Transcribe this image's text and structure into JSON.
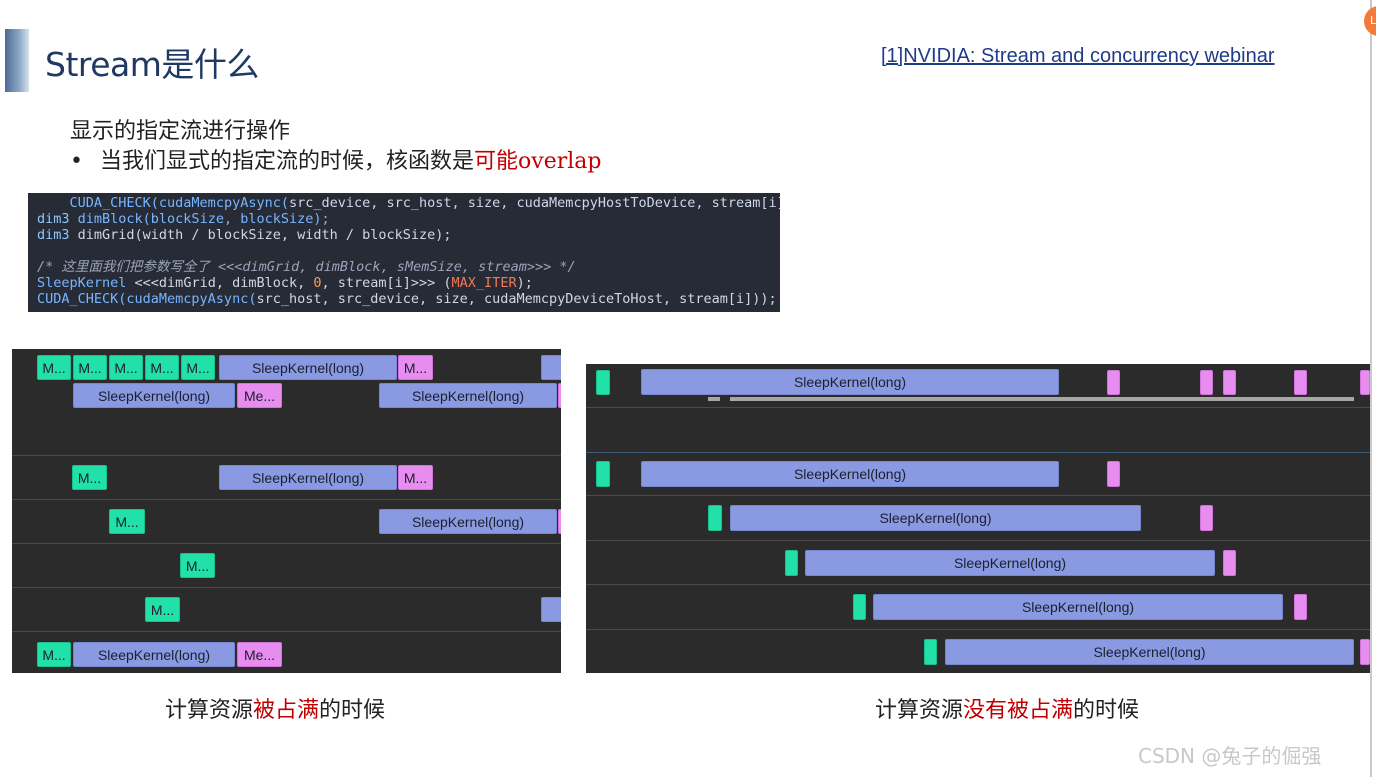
{
  "slide": {
    "title": "Stream是什么",
    "reference_link": "[1]NVIDIA: Stream and concurrency webinar",
    "badge": "L",
    "line1": "显示的指定流进行操作",
    "line2_bullet": "•",
    "line2_prefix": "当我们显式的指定流的时候，核函数是",
    "line2_highlight": "可能overlap",
    "caption_left_prefix": "计算资源",
    "caption_left_highlight": "被占满",
    "caption_left_suffix": "的时候",
    "caption_right_prefix": "计算资源",
    "caption_right_highlight": "没有被占满",
    "caption_right_suffix": "的时候",
    "watermark": "CSDN @兔子的倔强",
    "accent_color": "#c00000",
    "title_color": "#1f3864"
  },
  "code": {
    "l1_indent": "    ",
    "l1_fn": "CUDA_CHECK(cudaMemcpyAsync(",
    "l1_args": "src_device, src_host, size, cudaMemcpyHostToDevice, stream[i]));",
    "l2_type": "dim3 ",
    "l2_fn": "dimBlock(",
    "l2_args": "blockSize, blockSize);",
    "l3_type": "dim3 ",
    "l3_rest": "dimGrid(width / blockSize, width / blockSize);",
    "l5_comment": "/* 这里面我们把参数写全了 <<<dimGrid, dimBlock, sMemSize, stream>>> */",
    "l6_fn": "SleepKernel ",
    "l6_launch": "<<<dimGrid, dimBlock, ",
    "l6_zero": "0",
    "l6_stream": ", stream[i]>>> (",
    "l6_macro": "MAX_ITER",
    "l6_end": ");",
    "l7_fn": "CUDA_CHECK(cudaMemcpyAsync(",
    "l7_args": "src_host, src_device, size, cudaMemcpyDeviceToHost, stream[i]));"
  },
  "timeline_labels": {
    "memcpy_short": "M...",
    "memcpy_me": "Me...",
    "kernel": "SleepKernel(long)"
  },
  "colors": {
    "memcpy_htod": "#22e1a8",
    "kernel": "#8a9ae2",
    "memcpy_dtoh": "#e88df0",
    "panel_bg": "#2b2b2b"
  }
}
